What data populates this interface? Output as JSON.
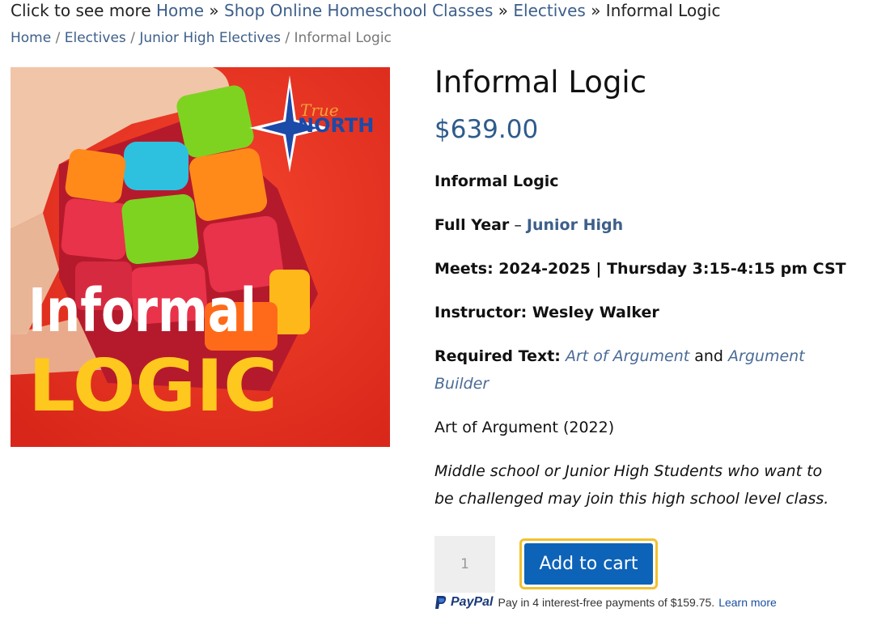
{
  "top_crumbs": {
    "prefix": "Click to see more ",
    "items": [
      "Home",
      "Shop Online Homeschool Classes",
      "Electives"
    ],
    "separator": " » ",
    "current": "Informal Logic"
  },
  "breadcrumb": {
    "items": [
      "Home",
      "Electives",
      "Junior High Electives"
    ],
    "separator": " / ",
    "current": "Informal Logic"
  },
  "image": {
    "logo_script": "True",
    "logo_word": "NORTH",
    "word1": "Informal",
    "word2": "LOGIC"
  },
  "product": {
    "title": "Informal Logic",
    "price": "$639.00",
    "subtitle": "Informal Logic",
    "term_label": "Full Year",
    "term_dash": " – ",
    "term_level": "Junior High",
    "meets": "Meets:  2024-2025 | Thursday 3:15-4:15 pm CST",
    "instructor": "Instructor: Wesley Walker",
    "required_label": "Required Text:",
    "book1": "Art of Argument",
    "and_text": " and ",
    "book2_a": "Argument",
    "book2_b": "Builder",
    "edition": "Art of Argument (2022)",
    "note_line1": "Middle school or Junior High Students who want to",
    "note_line2": "be challenged may join this high school level class."
  },
  "cart": {
    "quantity": "1",
    "add_label": "Add to cart"
  },
  "paypal": {
    "logo_text": "PayPal",
    "message": "Pay in 4 interest-free payments of $159.75.",
    "learn_more": "Learn more"
  },
  "colors": {
    "link": "#3d5f8a",
    "price": "#2e5b8c",
    "button": "#0d63b8",
    "button_outline": "#f2c12e"
  }
}
